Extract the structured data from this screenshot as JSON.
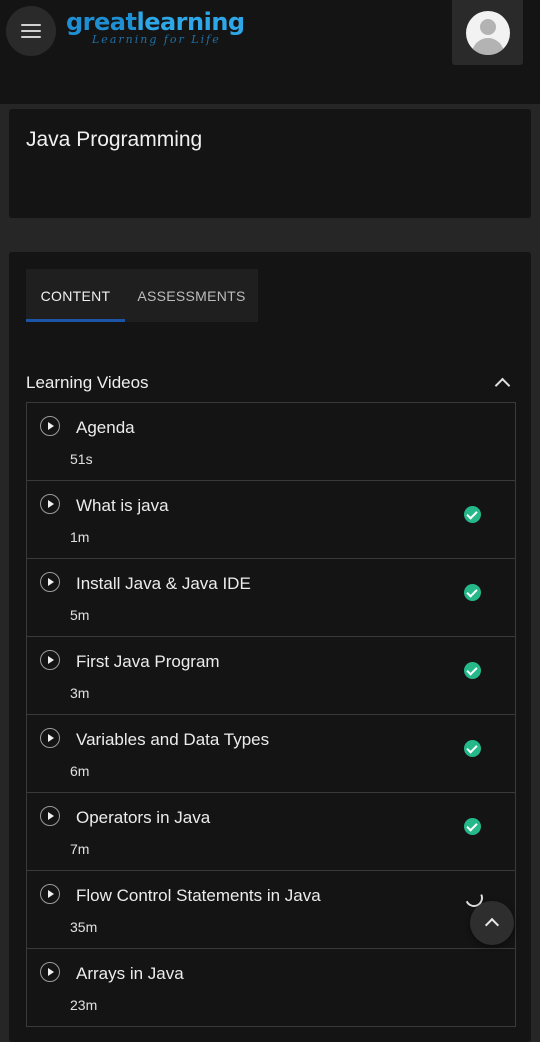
{
  "header": {
    "logo_main_1": "great",
    "logo_main_2": "learning",
    "logo_tagline": "Learning for Life",
    "menu_icon": "hamburger-menu-icon",
    "avatar_icon": "user-avatar-icon"
  },
  "course": {
    "title": "Java Programming"
  },
  "tabs": [
    {
      "label": "CONTENT",
      "active": true
    },
    {
      "label": "ASSESSMENTS",
      "active": false
    }
  ],
  "section": {
    "title": "Learning Videos",
    "expanded": true
  },
  "videos": [
    {
      "title": "Agenda",
      "duration": "51s",
      "status": "none"
    },
    {
      "title": "What is java",
      "duration": "1m",
      "status": "completed"
    },
    {
      "title": "Install Java & Java IDE",
      "duration": "5m",
      "status": "completed"
    },
    {
      "title": "First Java Program",
      "duration": "3m",
      "status": "completed"
    },
    {
      "title": "Variables and Data Types",
      "duration": "6m",
      "status": "completed"
    },
    {
      "title": "Operators in Java",
      "duration": "7m",
      "status": "completed"
    },
    {
      "title": "Flow Control Statements in Java",
      "duration": "35m",
      "status": "in-progress"
    },
    {
      "title": "Arrays in Java",
      "duration": "23m",
      "status": "none"
    }
  ],
  "colors": {
    "accent_blue": "#1b55a8",
    "completed_green": "#25b88a",
    "logo_blue": "#1f8fd3"
  }
}
